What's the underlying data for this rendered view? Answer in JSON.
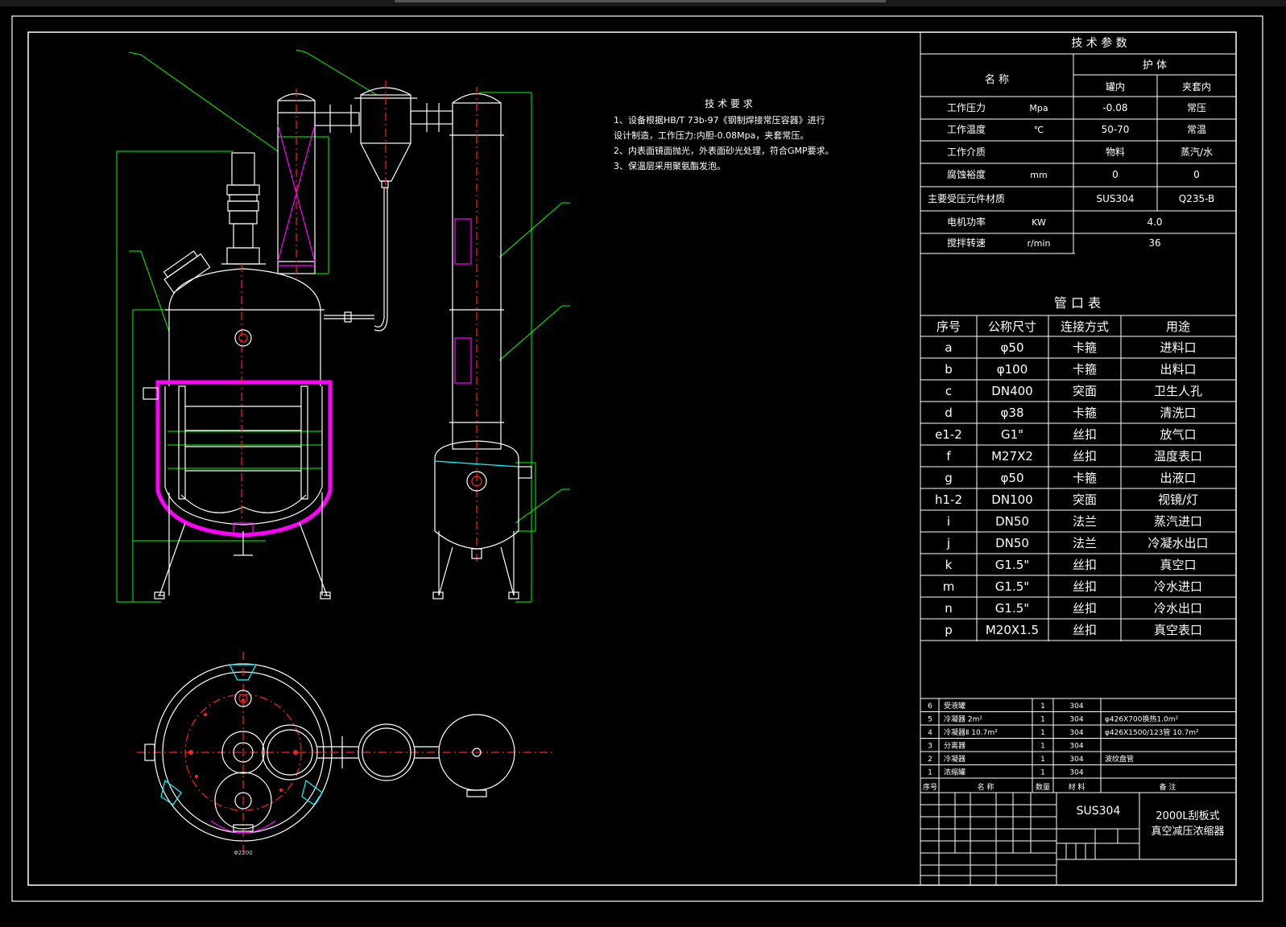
{
  "colors": {
    "background": "#000000",
    "line_white": "#ffffff",
    "dimension_green": "#00ff00",
    "centerline_red": "#ff2020",
    "jacket_magenta": "#ff00ff",
    "accent_cyan": "#00ffff"
  },
  "tech_requirements": {
    "title": "技 术 要 求",
    "lines": [
      "1、设备根据HB/T 73b-97《钢制焊接常压容器》进行",
      "设计制造，工作压力:内胆-0.08Mpa，夹套常压。",
      "2、内表面镜面抛光，外表面砂光处理，符合GMP要求。",
      "3、保温层采用聚氨酯发泡。"
    ]
  },
  "tech_params": {
    "title": "技 术 参 数",
    "header_name": "名    称",
    "header_group": "护    体",
    "header_inner": "罐内",
    "header_jacket": "夹套内",
    "rows": [
      {
        "name": "工作压力",
        "unit": "Mpa",
        "inner": "-0.08",
        "jacket": "常压"
      },
      {
        "name": "工作温度",
        "unit": "℃",
        "inner": "50-70",
        "jacket": "常温"
      },
      {
        "name": "工作介质",
        "unit": "",
        "inner": "物料",
        "jacket": "蒸汽/水"
      },
      {
        "name": "腐蚀裕度",
        "unit": "mm",
        "inner": "0",
        "jacket": "0"
      },
      {
        "name": "主要受压元件材质",
        "unit": "",
        "inner": "SUS304",
        "jacket": "Q235-B"
      },
      {
        "name": "电机功率",
        "unit": "KW",
        "merged": "4.0"
      },
      {
        "name": "搅拌转速",
        "unit": "r/min",
        "merged": "36"
      }
    ]
  },
  "nozzle_table": {
    "title": "管 口 表",
    "headers": [
      "序号",
      "公称尺寸",
      "连接方式",
      "用途"
    ],
    "rows": [
      [
        "a",
        "φ50",
        "卡箍",
        "进料口"
      ],
      [
        "b",
        "φ100",
        "卡箍",
        "出料口"
      ],
      [
        "c",
        "DN400",
        "突面",
        "卫生人孔"
      ],
      [
        "d",
        "φ38",
        "卡箍",
        "清洗口"
      ],
      [
        "e1-2",
        "G1\"",
        "丝扣",
        "放气口"
      ],
      [
        "f",
        "M27X2",
        "丝扣",
        "温度表口"
      ],
      [
        "g",
        "φ50",
        "卡箍",
        "出液口"
      ],
      [
        "h1-2",
        "DN100",
        "突面",
        "视镜/灯"
      ],
      [
        "i",
        "DN50",
        "法兰",
        "蒸汽进口"
      ],
      [
        "j",
        "DN50",
        "法兰",
        "冷凝水出口"
      ],
      [
        "k",
        "G1.5\"",
        "丝扣",
        "真空口"
      ],
      [
        "m",
        "G1.5\"",
        "丝扣",
        "冷水进口"
      ],
      [
        "n",
        "G1.5\"",
        "丝扣",
        "冷水出口"
      ],
      [
        "p",
        "M20X1.5",
        "丝扣",
        "真空表口"
      ]
    ]
  },
  "parts_list": {
    "rows": [
      [
        "6",
        "受液罐",
        "1",
        "304",
        ""
      ],
      [
        "5",
        "冷凝器 2m²",
        "1",
        "304",
        "φ426X700换热1.0m²"
      ],
      [
        "4",
        "冷凝器Ⅱ 10.7m²",
        "1",
        "304",
        "φ426X1500/123管 10.7m²"
      ],
      [
        "3",
        "分离器",
        "1",
        "304",
        ""
      ],
      [
        "2",
        "冷凝器",
        "1",
        "304",
        "波纹盘管"
      ],
      [
        "1",
        "浓缩罐",
        "1",
        "304",
        ""
      ]
    ],
    "header": [
      "序号",
      "名    称",
      "数量",
      "材 料",
      "备    注"
    ]
  },
  "title_block": {
    "material": "SUS304",
    "title_line1": "2000L刮板式",
    "title_line2": "真空减压浓缩器"
  },
  "labels": {
    "top_view_dim": "Φ2200"
  }
}
